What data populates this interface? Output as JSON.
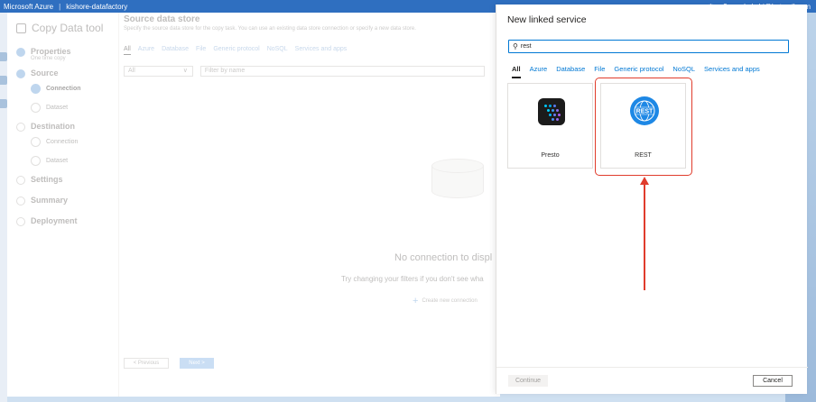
{
  "portal": {
    "brand": "Microsoft Azure",
    "resource": "kishore-datafactory",
    "user": "sakakchi@hotmail.com"
  },
  "wizard": {
    "title": "Copy Data tool",
    "steps": [
      {
        "label": "Properties",
        "sub": "One time copy"
      },
      {
        "label": "Source"
      },
      {
        "label": "Destination"
      },
      {
        "label": "Settings"
      },
      {
        "label": "Summary"
      },
      {
        "label": "Deployment"
      }
    ],
    "substeps": {
      "source_connection": "Connection",
      "source_dataset": "Dataset",
      "dest_connection": "Connection",
      "dest_dataset": "Dataset"
    },
    "main": {
      "heading": "Source data store",
      "description": "Specify the source data store for the copy task. You can use an existing data store connection or specify a new data store.",
      "tabs": [
        "All",
        "Azure",
        "Database",
        "File",
        "Generic protocol",
        "NoSQL",
        "Services and apps"
      ],
      "filter_select": "All",
      "filter_placeholder": "Filter by name",
      "empty_title": "No connection to displ",
      "empty_hint": "Try changing your filters if you don't see wha",
      "create_new": "Create new connection"
    },
    "footer": {
      "previous": "< Previous",
      "next": "Next >"
    }
  },
  "panel": {
    "title": "New linked service",
    "search_value": "rest",
    "tabs": [
      "All",
      "Azure",
      "Database",
      "File",
      "Generic protocol",
      "NoSQL",
      "Services and apps"
    ],
    "tiles": [
      {
        "name": "Presto",
        "icon": "presto-icon"
      },
      {
        "name": "REST",
        "icon": "rest-globe-icon",
        "badge": "REST"
      }
    ],
    "continue_label": "Continue",
    "cancel_label": "Cancel"
  },
  "colors": {
    "accent": "#0078d4",
    "annotation": "#e03c2c",
    "rest_blue": "#1e88e5"
  }
}
